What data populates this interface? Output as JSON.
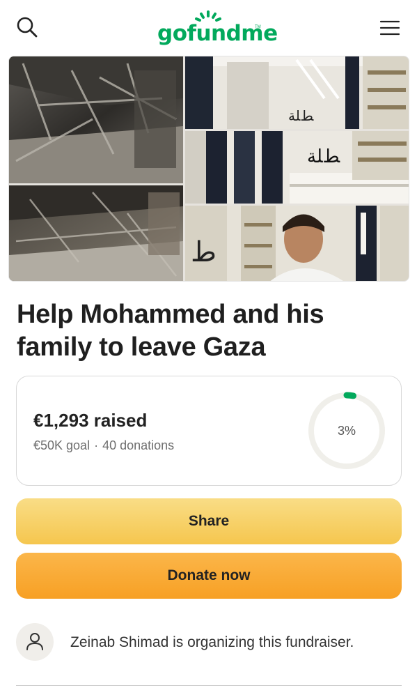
{
  "header": {
    "logo_text": "gofundme",
    "logo_tm": "TM",
    "search_icon": "search-icon",
    "menu_icon": "hamburger-menu-icon",
    "brand_color": "#02a95c"
  },
  "gallery": {
    "photos": [
      {
        "name": "burned-building-interior-1"
      },
      {
        "name": "perfume-shop-interior-1"
      },
      {
        "name": "perfume-shop-interior-2"
      },
      {
        "name": "burned-building-interior-2"
      },
      {
        "name": "mohammed-in-shop"
      }
    ]
  },
  "campaign": {
    "title": "Help Mohammed and his family to leave Gaza"
  },
  "progress": {
    "raised_text": "€1,293 raised",
    "goal_text": "€50K goal",
    "separator": "·",
    "donations_text": "40 donations",
    "percent_text": "3%",
    "percent_value": 3,
    "ring_color": "#02a95c",
    "ring_track_color": "#f0efea"
  },
  "actions": {
    "share_label": "Share",
    "donate_label": "Donate now",
    "share_color": "#f7cf62",
    "donate_color": "#f9aa33"
  },
  "organizer": {
    "text": "Zeinab Shimad is organizing this fundraiser.",
    "avatar_icon": "user-icon"
  }
}
